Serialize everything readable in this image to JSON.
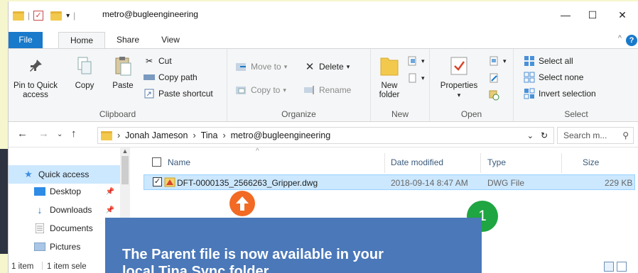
{
  "window": {
    "title": "metro@bugleengineering",
    "controls": {
      "minimize": "—",
      "maximize": "☐",
      "close": "✕"
    }
  },
  "tabs": [
    {
      "label": "File",
      "active": false
    },
    {
      "label": "Home",
      "active": true
    },
    {
      "label": "Share",
      "active": false
    },
    {
      "label": "View",
      "active": false
    }
  ],
  "ribbon": {
    "clipboard": {
      "label": "Clipboard",
      "pin_to_quick_access": "Pin to Quick access",
      "copy": "Copy",
      "paste": "Paste",
      "cut": "Cut",
      "copy_path": "Copy path",
      "paste_shortcut": "Paste shortcut"
    },
    "organize": {
      "label": "Organize",
      "move_to": "Move to",
      "delete": "Delete",
      "copy_to": "Copy to",
      "rename": "Rename"
    },
    "new": {
      "label": "New",
      "new_folder": "New folder"
    },
    "open": {
      "label": "Open",
      "properties": "Properties"
    },
    "select": {
      "label": "Select",
      "select_all": "Select all",
      "select_none": "Select none",
      "invert_selection": "Invert selection"
    }
  },
  "address": {
    "breadcrumbs": [
      "Jonah Jameson",
      "Tina",
      "metro@bugleengineering"
    ],
    "search_placeholder": "Search m..."
  },
  "nav": {
    "items": [
      {
        "label": "Quick access",
        "selected": true
      },
      {
        "label": "Desktop",
        "pinned": true
      },
      {
        "label": "Downloads",
        "pinned": true
      },
      {
        "label": "Documents",
        "pinned": false
      },
      {
        "label": "Pictures",
        "pinned": false
      }
    ]
  },
  "columns": {
    "name": "Name",
    "date": "Date modified",
    "type": "Type",
    "size": "Size"
  },
  "files": [
    {
      "name": "DFT-0000135_2566263_Gripper.dwg",
      "date": "2018-09-14 8:47 AM",
      "type": "DWG File",
      "size": "229 KB",
      "selected": true
    }
  ],
  "status": {
    "items": "1 item",
    "selected": "1 item sele"
  },
  "callout": {
    "text_line1": "The Parent file is now available in your",
    "text_line2": "local Tina Sync folder",
    "step_number": "1"
  },
  "colors": {
    "accent": "#1979ca",
    "callout": "#4a78b9",
    "step": "#1fa541",
    "arrow": "#f26a24",
    "selection": "#cce8ff"
  }
}
